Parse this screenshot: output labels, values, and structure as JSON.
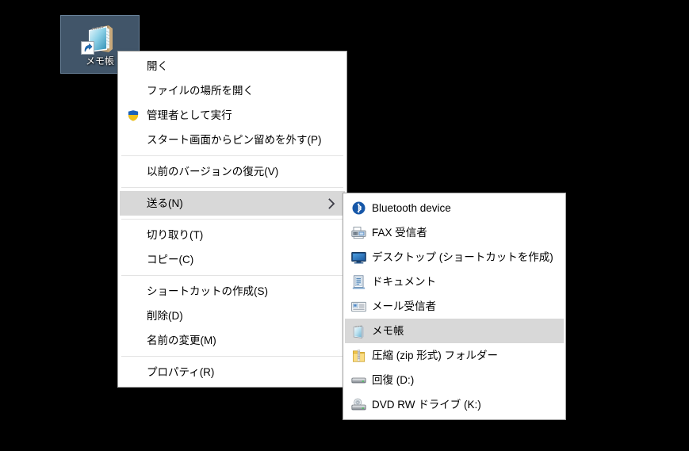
{
  "desktop": {
    "icon": {
      "label": "メモ帳",
      "icon_name": "notepad-icon",
      "badge_icon": "shortcut-arrow-icon",
      "selected": true
    },
    "background_color": "#000000",
    "selection_color": "#465c72"
  },
  "context_menu": {
    "name": "file-context-menu",
    "items": [
      {
        "type": "item",
        "label": "開く",
        "icon": null
      },
      {
        "type": "item",
        "label": "ファイルの場所を開く",
        "icon": null
      },
      {
        "type": "item",
        "label": "管理者として実行",
        "icon": "uac-shield-icon"
      },
      {
        "type": "item",
        "label": "スタート画面からピン留めを外す(P)",
        "icon": null
      },
      {
        "type": "separator"
      },
      {
        "type": "item",
        "label": "以前のバージョンの復元(V)",
        "icon": null
      },
      {
        "type": "separator"
      },
      {
        "type": "item",
        "label": "送る(N)",
        "icon": null,
        "submenu": true,
        "selected": true,
        "arrow_icon": "chevron-right-icon"
      },
      {
        "type": "separator"
      },
      {
        "type": "item",
        "label": "切り取り(T)",
        "icon": null
      },
      {
        "type": "item",
        "label": "コピー(C)",
        "icon": null
      },
      {
        "type": "separator"
      },
      {
        "type": "item",
        "label": "ショートカットの作成(S)",
        "icon": null
      },
      {
        "type": "item",
        "label": "削除(D)",
        "icon": null
      },
      {
        "type": "item",
        "label": "名前の変更(M)",
        "icon": null
      },
      {
        "type": "separator"
      },
      {
        "type": "item",
        "label": "プロパティ(R)",
        "icon": null
      }
    ],
    "highlight_color": "#d8d8d8",
    "border_color": "#a0a0a0"
  },
  "send_to_submenu": {
    "name": "send-to-submenu",
    "items": [
      {
        "type": "item",
        "label": "Bluetooth device",
        "icon": "bluetooth-icon"
      },
      {
        "type": "item",
        "label": "FAX 受信者",
        "icon": "fax-icon"
      },
      {
        "type": "item",
        "label": "デスクトップ (ショートカットを作成)",
        "icon": "desktop-monitor-icon"
      },
      {
        "type": "item",
        "label": "ドキュメント",
        "icon": "documents-icon"
      },
      {
        "type": "item",
        "label": "メール受信者",
        "icon": "mail-icon"
      },
      {
        "type": "item",
        "label": "メモ帳",
        "icon": "notepad-small-icon",
        "selected": true
      },
      {
        "type": "item",
        "label": "圧縮 (zip 形式) フォルダー",
        "icon": "zip-folder-icon"
      },
      {
        "type": "item",
        "label": "回復 (D:)",
        "icon": "hard-drive-icon"
      },
      {
        "type": "item",
        "label": "DVD RW ドライブ (K:)",
        "icon": "dvd-drive-icon"
      }
    ],
    "highlight_color": "#d8d8d8",
    "border_color": "#a0a0a0"
  }
}
